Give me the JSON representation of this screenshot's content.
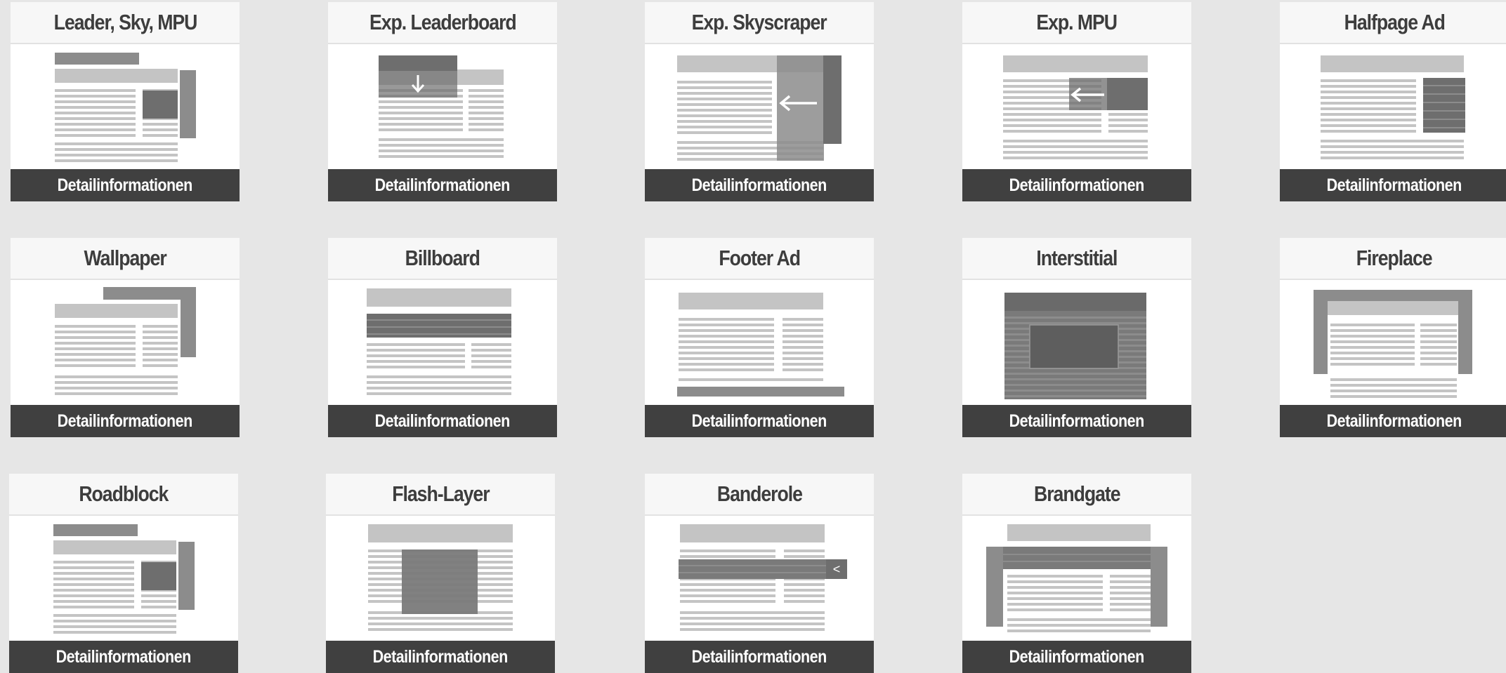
{
  "cards": [
    {
      "title": "Leader, Sky, MPU",
      "button": "Detailinformationen",
      "icon": "leader-sky-mpu-icon"
    },
    {
      "title": "Exp. Leaderboard",
      "button": "Detailinformationen",
      "icon": "expandable-leaderboard-icon"
    },
    {
      "title": "Exp. Skyscraper",
      "button": "Detailinformationen",
      "icon": "expandable-skyscraper-icon"
    },
    {
      "title": "Exp. MPU",
      "button": "Detailinformationen",
      "icon": "expandable-mpu-icon"
    },
    {
      "title": "Halfpage Ad",
      "button": "Detailinformationen",
      "icon": "halfpage-ad-icon"
    },
    {
      "title": "Wallpaper",
      "button": "Detailinformationen",
      "icon": "wallpaper-icon"
    },
    {
      "title": "Billboard",
      "button": "Detailinformationen",
      "icon": "billboard-icon"
    },
    {
      "title": "Footer Ad",
      "button": "Detailinformationen",
      "icon": "footer-ad-icon"
    },
    {
      "title": "Interstitial",
      "button": "Detailinformationen",
      "icon": "interstitial-icon"
    },
    {
      "title": "Fireplace",
      "button": "Detailinformationen",
      "icon": "fireplace-icon"
    },
    {
      "title": "Roadblock",
      "button": "Detailinformationen",
      "icon": "roadblock-icon"
    },
    {
      "title": "Flash-Layer",
      "button": "Detailinformationen",
      "icon": "flash-layer-icon"
    },
    {
      "title": "Banderole",
      "button": "Detailinformationen",
      "icon": "banderole-icon"
    },
    {
      "title": "Brandgate",
      "button": "Detailinformationen",
      "icon": "brandgate-icon"
    }
  ],
  "banderole_close_glyph": "<",
  "colors": {
    "background": "#e6e6e6",
    "card": "#ffffff",
    "title_bar": "#f7f7f7",
    "title_text": "#3d3d3d",
    "button_bg": "#404040",
    "button_text": "#ffffff",
    "page_line": "#c0c0c0",
    "ad_dark": "#6e6e6e",
    "ad_mid": "#8c8c8c"
  }
}
